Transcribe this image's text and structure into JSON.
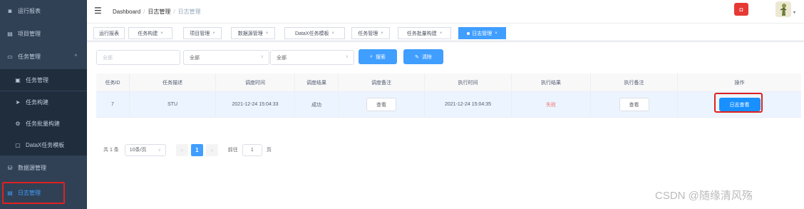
{
  "sidebar": {
    "items": [
      {
        "icon": "dashboard-icon",
        "glyph": "◙",
        "label": "运行报表"
      },
      {
        "icon": "project-icon",
        "glyph": "▤",
        "label": "项目管理"
      },
      {
        "icon": "monitor-icon",
        "glyph": "▭",
        "label": "任务管理",
        "caret": "^"
      },
      {
        "icon": "task-icon",
        "glyph": "▣",
        "label": "任务管理"
      },
      {
        "icon": "send-icon",
        "glyph": "➤",
        "label": "任务构建"
      },
      {
        "icon": "settings-icon",
        "glyph": "⚙",
        "label": "任务批量构建"
      },
      {
        "icon": "template-icon",
        "glyph": "▢",
        "label": "DataX任务模板"
      },
      {
        "icon": "database-icon",
        "glyph": "⛁",
        "label": "数据源管理"
      },
      {
        "icon": "log-icon",
        "glyph": "▤",
        "label": "日志管理"
      }
    ]
  },
  "navbar": {
    "hamburger": "☰",
    "breadcrumb": [
      "Dashboard",
      "日志管理",
      "日志管理"
    ],
    "separator": "/",
    "notice_glyph": "◘",
    "avatar_caret": "▾"
  },
  "tags": [
    {
      "label": "运行报表",
      "closable": false
    },
    {
      "label": "任务构建",
      "closable": true
    },
    {
      "label": "项目管理",
      "closable": true
    },
    {
      "label": "数据源管理",
      "closable": true
    },
    {
      "label": "DataX任务模板",
      "closable": true
    },
    {
      "label": "任务管理",
      "closable": true
    },
    {
      "label": "任务批量构建",
      "closable": true
    },
    {
      "label": "日志管理",
      "closable": true,
      "active": true
    }
  ],
  "tag_close": "×",
  "filters": {
    "executor_placeholder": "全部",
    "job_value": "全部",
    "status_value": "全部",
    "arrow": "∨",
    "search_label": "搜索",
    "search_glyph": "⌕",
    "clear_label": "清除",
    "clear_glyph": "✎"
  },
  "table": {
    "columns": [
      "任务ID",
      "任务描述",
      "调度时间",
      "调度结果",
      "调度备注",
      "执行时间",
      "执行结果",
      "执行备注",
      "操作"
    ],
    "rows": [
      {
        "job_id": "7",
        "desc": "STU",
        "trigger_time": "2021-12-24 15:04:33",
        "trigger_result": "成功",
        "trigger_note_btn": "查看",
        "handle_time": "2021-12-24 15:04:35",
        "handle_result": "失败",
        "handle_note_btn": "查看",
        "op_btn": "日志查看"
      }
    ]
  },
  "pagination": {
    "total": "共 1 条",
    "page_size": "10条/页",
    "prev": "‹",
    "current": "1",
    "next": "›",
    "goto_prefix": "前往",
    "goto_value": "1",
    "goto_suffix": "页"
  },
  "colors": {
    "sidebar_bg": "#304156",
    "primary": "#409eff",
    "danger": "#f56c6c",
    "highlight_box": "#e02020"
  },
  "watermark": "CSDN @随缘清风殇"
}
